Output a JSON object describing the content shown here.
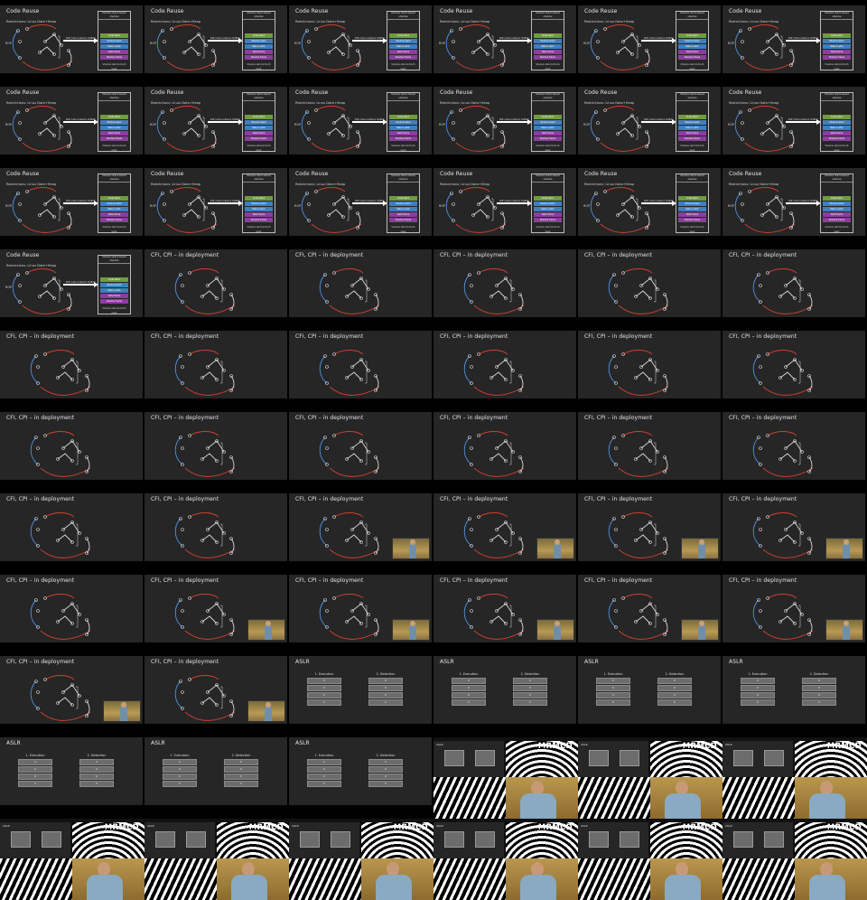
{
  "slides": {
    "code_reuse": {
      "title": "Code Reuse",
      "subtitle": "Restrictions: Linux Data+Heap",
      "rop": "ROP",
      "arrow_label": "RIP /return/stack 0x80?",
      "stack_header": "Shadow stack-based shadow",
      "blocks": [
        {
          "label": "Code stack",
          "color": "#6f9c3e"
        },
        {
          "label": "Shadow stack",
          "color": "#3f7fc0"
        },
        {
          "label": "Return addr",
          "color": "#3f7fc0"
        },
        {
          "label": "Data frame",
          "color": "#8a3f9c"
        },
        {
          "label": "Shadow frame",
          "color": "#8a3f9c"
        }
      ],
      "footer": "Shadow stack/intra-fb level"
    },
    "cfi": {
      "title": "CFI, CPI – in deployment"
    },
    "aslr": {
      "title": "ASLR",
      "col1": "1. Execution",
      "col2": "2. Detection",
      "rows": [
        "0",
        "0",
        "0",
        "0"
      ]
    },
    "mrmcd": {
      "logo": "MRMCD",
      "mini_title": "ASLR"
    }
  },
  "colors": {
    "background": "#000000",
    "slide": "#262626",
    "diagram_blue": "#4f8fe0",
    "diagram_red": "#d04030"
  },
  "frames": [
    "code",
    "code",
    "code",
    "code",
    "code",
    "code",
    "code",
    "code",
    "code",
    "code",
    "code",
    "code",
    "code",
    "code",
    "code",
    "code",
    "code",
    "code",
    "code",
    "cfi",
    "cfi",
    "cfi",
    "cfi",
    "cfi",
    "cfi",
    "cfi",
    "cfi",
    "cfi",
    "cfi",
    "cfi",
    "cfi",
    "cfi",
    "cfi",
    "cfi",
    "cfi",
    "cfi",
    "cfi",
    "cfi",
    "cfi-cam",
    "cfi-cam",
    "cfi-cam",
    "cfi-cam",
    "cfi",
    "cfi-cam",
    "cfi-cam",
    "cfi-cam",
    "cfi-cam",
    "cfi-cam",
    "cfi-cam",
    "cfi-cam",
    "aslr",
    "aslr",
    "aslr",
    "aslr",
    "aslr",
    "aslr",
    "aslr",
    "mrmcd",
    "mrmcd",
    "mrmcd",
    "mrmcd",
    "mrmcd",
    "mrmcd",
    "mrmcd",
    "mrmcd",
    "mrmcd"
  ]
}
